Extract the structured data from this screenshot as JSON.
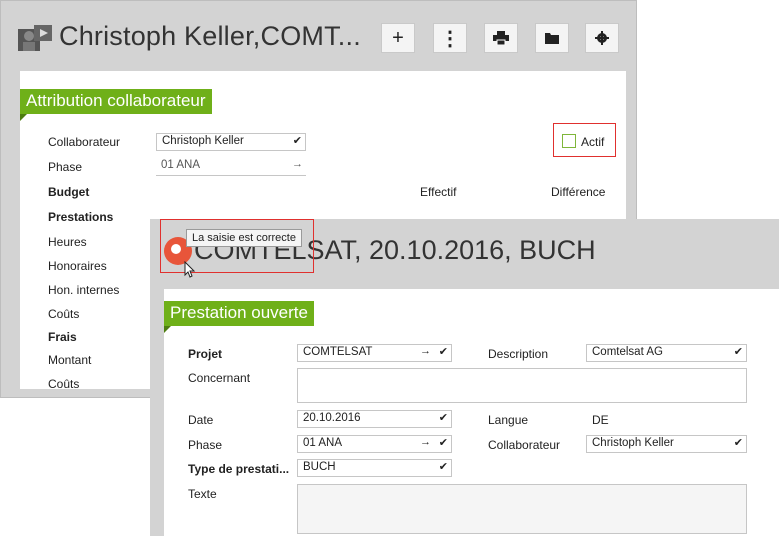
{
  "back_window": {
    "title": "Christoph Keller,COMT...",
    "toolbar": {
      "add_label": "+",
      "more_label": "⋮",
      "print_label": "🖶",
      "folder_label": "▬",
      "settings_label": "✹"
    },
    "section_title": "Attribution collaborateur",
    "fields": {
      "collaborateur_label": "Collaborateur",
      "collaborateur_value": "Christoph Keller",
      "phase_label": "Phase",
      "phase_value": "01 ANA",
      "actif_label": "Actif"
    },
    "budget": {
      "budget_label": "Budget",
      "effectif_label": "Effectif",
      "difference_label": "Différence"
    },
    "rows": [
      {
        "label": "Prestations",
        "bold": true
      },
      {
        "label": "Heures",
        "bold": false
      },
      {
        "label": "Honoraires",
        "bold": false
      },
      {
        "label": "Hon. internes",
        "bold": false
      },
      {
        "label": "Coûts",
        "bold": false
      },
      {
        "label": "Frais",
        "bold": true
      },
      {
        "label": "Montant",
        "bold": false
      },
      {
        "label": "Coûts",
        "bold": false
      }
    ]
  },
  "front_window": {
    "title": "COMTELSAT, 20.10.2016, BUCH",
    "tooltip": "La saisie est correcte",
    "section_title": "Prestation ouverte",
    "fields": {
      "projet_label": "Projet",
      "projet_value": "COMTELSAT",
      "description_label": "Description",
      "description_value": "Comtelsat AG",
      "concernant_label": "Concernant",
      "concernant_value": "",
      "date_label": "Date",
      "date_value": "20.10.2016",
      "langue_label": "Langue",
      "langue_value": "DE",
      "phase_label": "Phase",
      "phase_value": "01 ANA",
      "collaborateur_label": "Collaborateur",
      "collaborateur_value": "Christoph Keller",
      "type_label": "Type de prestati...",
      "type_value": "BUCH",
      "texte_label": "Texte",
      "texte_value": ""
    }
  },
  "colors": {
    "accent_green": "#6fb019",
    "error_red": "#e0302e",
    "status_orange": "#e8553a"
  }
}
